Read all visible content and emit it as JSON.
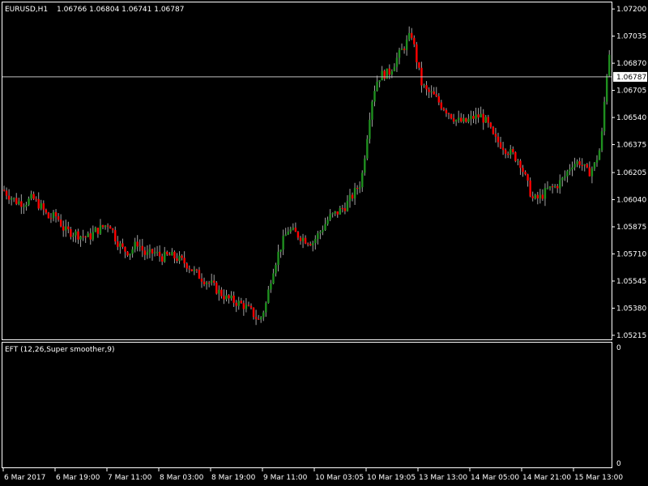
{
  "colors": {
    "background": "#000000",
    "foreground": "#ffffff",
    "bull": "#1f8f1f",
    "bear": "#ff0000",
    "wick": "#a0a0a0"
  },
  "header": {
    "symbol": "EURUSD,H1",
    "ohlc": "1.06766 1.06804 1.06741 1.06787"
  },
  "indicator": {
    "label": "EFT (12,26,Super smoother,9)",
    "scale_top": "0",
    "scale_bottom": "0"
  },
  "chart_data": {
    "type": "candlestick",
    "title": "EURUSD,H1",
    "y_ticks": [
      "1.07200",
      "1.07035",
      "1.06870",
      "1.06705",
      "1.06540",
      "1.06375",
      "1.06205",
      "1.06040",
      "1.05875",
      "1.05710",
      "1.05545",
      "1.05380",
      "1.05215"
    ],
    "ylim": [
      1.05195,
      1.07235
    ],
    "x_ticks": [
      "6 Mar 2017",
      "6 Mar 19:00",
      "7 Mar 11:00",
      "8 Mar 03:00",
      "8 Mar 19:00",
      "9 Mar 11:00",
      "10 Mar 03:05",
      "10 Mar 19:05",
      "13 Mar 13:00",
      "14 Mar 05:00",
      "14 Mar 21:00",
      "15 Mar 13:00"
    ],
    "current_price": 1.06787,
    "current_price_label": "1.06787",
    "grid": false,
    "close_path": [
      [
        0,
        1.0612
      ],
      [
        10,
        1.0607
      ],
      [
        20,
        1.0603
      ],
      [
        30,
        1.0602
      ],
      [
        40,
        1.0605
      ],
      [
        50,
        1.06
      ],
      [
        60,
        1.0593
      ],
      [
        70,
        1.0594
      ],
      [
        80,
        1.0585
      ],
      [
        90,
        1.0584
      ],
      [
        100,
        1.0582
      ],
      [
        110,
        1.0581
      ],
      [
        118,
        1.0585
      ],
      [
        126,
        1.0587
      ],
      [
        135,
        1.059
      ],
      [
        143,
        1.058
      ],
      [
        151,
        1.0574
      ],
      [
        160,
        1.0572
      ],
      [
        170,
        1.0578
      ],
      [
        180,
        1.057
      ],
      [
        190,
        1.0572
      ],
      [
        200,
        1.0569
      ],
      [
        210,
        1.057
      ],
      [
        220,
        1.0568
      ],
      [
        230,
        1.0565
      ],
      [
        240,
        1.056
      ],
      [
        250,
        1.0556
      ],
      [
        260,
        1.0553
      ],
      [
        270,
        1.0548
      ],
      [
        280,
        1.0544
      ],
      [
        290,
        1.0542
      ],
      [
        300,
        1.054
      ],
      [
        310,
        1.0536
      ],
      [
        320,
        1.053
      ],
      [
        328,
        1.054
      ],
      [
        336,
        1.056
      ],
      [
        346,
        1.0575
      ],
      [
        356,
        1.0586
      ],
      [
        366,
        1.0583
      ],
      [
        376,
        1.058
      ],
      [
        386,
        1.0578
      ],
      [
        396,
        1.0585
      ],
      [
        406,
        1.0593
      ],
      [
        416,
        1.0596
      ],
      [
        426,
        1.06
      ],
      [
        436,
        1.0607
      ],
      [
        446,
        1.0615
      ],
      [
        452,
        1.0638
      ],
      [
        458,
        1.0662
      ],
      [
        464,
        1.0675
      ],
      [
        470,
        1.068
      ],
      [
        480,
        1.0681
      ],
      [
        490,
        1.069
      ],
      [
        500,
        1.0698
      ],
      [
        508,
        1.0705
      ],
      [
        514,
        1.069
      ],
      [
        520,
        1.0675
      ],
      [
        526,
        1.067
      ],
      [
        534,
        1.0668
      ],
      [
        544,
        1.0662
      ],
      [
        554,
        1.0657
      ],
      [
        564,
        1.0652
      ],
      [
        574,
        1.0651
      ],
      [
        584,
        1.0654
      ],
      [
        594,
        1.0655
      ],
      [
        602,
        1.065
      ],
      [
        610,
        1.0641
      ],
      [
        618,
        1.0638
      ],
      [
        626,
        1.0634
      ],
      [
        634,
        1.0631
      ],
      [
        642,
        1.0627
      ],
      [
        650,
        1.0615
      ],
      [
        658,
        1.0604
      ],
      [
        666,
        1.0605
      ],
      [
        676,
        1.061
      ],
      [
        686,
        1.0612
      ],
      [
        696,
        1.0617
      ],
      [
        706,
        1.0626
      ],
      [
        716,
        1.0627
      ],
      [
        726,
        1.062
      ],
      [
        734,
        1.0625
      ],
      [
        742,
        1.0637
      ],
      [
        748,
        1.0675
      ],
      [
        752,
        1.0695
      ],
      [
        755,
        1.06787
      ]
    ]
  }
}
